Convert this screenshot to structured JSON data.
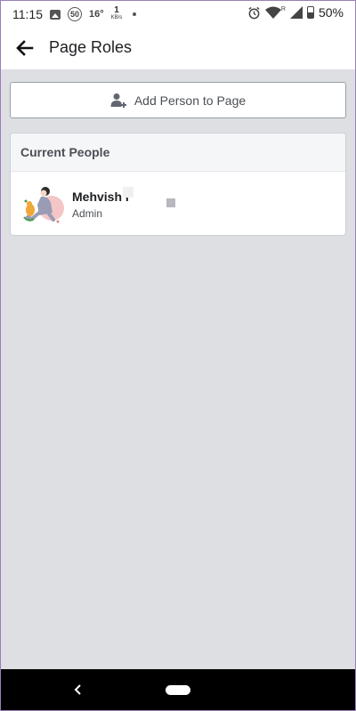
{
  "status_bar": {
    "time": "11:15",
    "notification_count": "50",
    "temperature": "16°",
    "speed_value": "1",
    "speed_unit": "KB/s",
    "signal_tag": "R",
    "battery": "50%"
  },
  "app_bar": {
    "title": "Page Roles"
  },
  "add_person": {
    "label": "Add Person to Page"
  },
  "current_people": {
    "header": "Current People",
    "people": [
      {
        "name": "Mehvish I",
        "role": "Admin"
      }
    ]
  },
  "colors": {
    "page_background": "#dddfe3",
    "header_background": "#f5f6f7",
    "text_primary": "#1c1e21",
    "text_secondary": "#4b4f56"
  }
}
